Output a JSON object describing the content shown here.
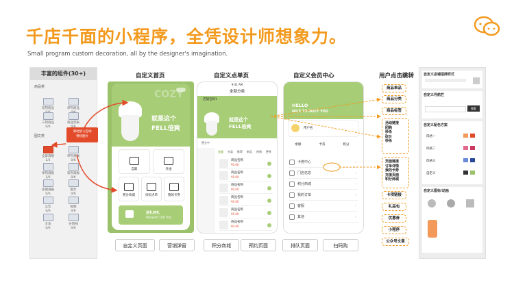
{
  "header": {
    "title": "千店千面的小程序，全凭设计师想象力。",
    "subtitle": "Small program custom decoration, all by the designer's imagination."
  },
  "icons": {
    "top_right": "wechat-icon"
  },
  "colors": {
    "accent": "#f39a1e",
    "green": "#9bc26a",
    "red": "#e34a2a"
  },
  "components_panel": {
    "title": "丰富的组件(30+)",
    "categories": [
      "商品类",
      "图文类"
    ],
    "items": [
      {
        "label": "双列商品",
        "count": "0/6"
      },
      {
        "label": "单列商品",
        "count": "0/6"
      },
      {
        "label": "三列商品",
        "count": "0/6"
      },
      {
        "label": "商品列表",
        "count": "0/6"
      },
      {
        "label": "全屏海报",
        "count": "1/1"
      },
      {
        "label": "单列海报",
        "count": "0/6"
      },
      {
        "label": "单列海报",
        "count": "1/6"
      },
      {
        "label": "双列海报",
        "count": "0/6"
      },
      {
        "label": "多图海报",
        "count": "0/6"
      },
      {
        "label": "图文",
        "count": "0/6"
      },
      {
        "label": "公告",
        "count": "0/6"
      },
      {
        "label": "视频",
        "count": "0/6"
      },
      {
        "label": "文本",
        "count": "0/6"
      },
      {
        "label": "分割线",
        "count": "0/6"
      }
    ],
    "callout": [
      "滑动鼠标自动",
      "预热图片",
      "双击选框",
      "修改"
    ]
  },
  "captions": {
    "home": "自定义首页",
    "menu": "自定义点单页",
    "member": "自定义会员中心",
    "redirect": "用户点击跳转"
  },
  "home": {
    "banner": {
      "line1": "就是这个",
      "line2": "FELL倍爽",
      "watermark": "COZY"
    },
    "tiles": [
      "自取",
      "外送",
      "积分商城",
      "扫码点单",
      "我的卡券"
    ],
    "promo": {
      "line1": "送礼有礼",
      "line2": "PRESENT FOR YOU"
    }
  },
  "menu": {
    "status": "9:41 AM",
    "title": "全部分类",
    "shop": "店铺名称1",
    "shop_sub": "营业中",
    "tabs": [
      "全部",
      "分类",
      "推荐",
      "新品",
      "热销",
      "更多"
    ],
    "goods_name": "商品名称",
    "goods_price": "¥0.00",
    "goods_count": 6
  },
  "member": {
    "hello": "HELLO",
    "welcome": "NICE TO MEET YOU",
    "user": "用户名",
    "stats": [
      "余额",
      "卡券",
      "积分"
    ],
    "menu": [
      "卡券中心",
      "门店信息",
      "积分商城",
      "我的订单",
      "客服",
      "其他"
    ]
  },
  "redirects": [
    "商品单品",
    "商品分类",
    "商品标签",
    "活动链接\n团购\n秒杀\n砍价\n秒杀",
    "页面链接\n订单详情\n我的卡券\n充值页面\n积分商城",
    "卡项链接",
    "礼品包",
    "优惠券",
    "小程序",
    "公众号文章"
  ],
  "tabs": [
    "自定义页面",
    "营销弹窗",
    "积分商城",
    "预约页面",
    "排队页面",
    "扫码购"
  ],
  "settings_panel": {
    "sections": [
      "自定义店铺招牌样式",
      "自定义导航栏",
      "自定义配色方案",
      "自定义图标/动画"
    ],
    "nav_button": "搜索",
    "palette": [
      {
        "name": "风格一",
        "colors": [
          "#f39a5a",
          "#e04a2b"
        ]
      },
      {
        "name": "风格二",
        "colors": [
          "#e06a8a",
          "#c83a5e"
        ]
      },
      {
        "name": "风格三",
        "colors": [
          "#6a8ad8",
          "#2a4a98"
        ]
      },
      {
        "name": "自定义",
        "colors": [
          "#333333",
          "#9bc26a"
        ]
      }
    ]
  }
}
